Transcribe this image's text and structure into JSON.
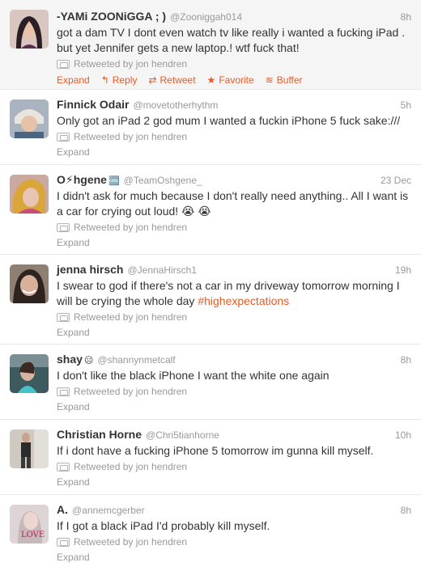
{
  "tweets": [
    {
      "name": "-YAMi ZOONiGGA ; )",
      "handle": "@Zooniggah014",
      "time": "8h",
      "text": "got a dam TV I dont even watch tv like really i wanted a fucking iPad . but yet Jennifer gets a new laptop.! wtf fuck that!",
      "retweeted_by": "Retweeted by jon hendren",
      "expand": "Expand",
      "actions": {
        "reply": "Reply",
        "retweet": "Retweet",
        "favorite": "Favorite",
        "buffer": "Buffer"
      }
    },
    {
      "name": "Finnick Odair",
      "handle": "@movetotherhythm",
      "time": "5h",
      "text": "Only got an iPad 2 god mum I wanted a fuckin iPhone 5 fuck sake:///",
      "retweeted_by": "Retweeted by jon hendren",
      "expand": "Expand"
    },
    {
      "name": "O⚡hgene",
      "name_extra": "🆒",
      "handle": "@TeamOshgene_",
      "time": "23 Dec",
      "text": "I didn't ask for much because I don't really need anything.. All I want is a car for crying out loud! 😭 😭",
      "retweeted_by": "Retweeted by jon hendren",
      "expand": "Expand"
    },
    {
      "name": "jenna hirsch",
      "handle": "@JennaHirsch1",
      "time": "19h",
      "text_main": "I swear to god if there's not a car in my driveway tomorrow morning I will be crying the whole day ",
      "hashtag": "#highexpectations",
      "retweeted_by": "Retweeted by jon hendren",
      "expand": "Expand"
    },
    {
      "name": "shay",
      "name_extra": "☹",
      "handle": "@shannynmetcalf",
      "time": "8h",
      "text": "I don't like the black iPhone I want the white one again",
      "retweeted_by": "Retweeted by jon hendren",
      "expand": "Expand"
    },
    {
      "name": "Christian Horne",
      "handle": "@Chri5tianhorne",
      "time": "10h",
      "text": "If i dont have a fucking iPhone 5 tomorrow im gunna kill myself.",
      "retweeted_by": "Retweeted by jon hendren",
      "expand": "Expand"
    },
    {
      "name": "A.",
      "handle": "@annemcgerber",
      "time": "8h",
      "text": "If I got a black iPad I'd probably kill myself.",
      "retweeted_by": "Retweeted by jon hendren",
      "expand": "Expand",
      "avatar_text": "LOVE"
    }
  ],
  "colors": {
    "accent": "#e85a24",
    "muted": "#999999",
    "text": "#333333"
  },
  "icons": {
    "reply": "reply-arrow-icon",
    "retweet": "retweet-icon",
    "favorite": "star-icon",
    "buffer": "buffer-stack-icon",
    "retweeted": "retweet-badge-icon"
  }
}
